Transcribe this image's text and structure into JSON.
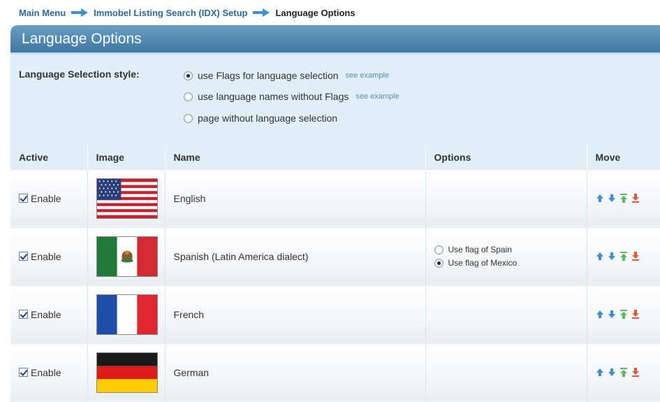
{
  "breadcrumb": {
    "items": [
      "Main Menu",
      "Immobel Listing Search (IDX) Setup"
    ],
    "current": "Language Options"
  },
  "panel": {
    "title": "Language Options"
  },
  "selection_style": {
    "label": "Language Selection style:",
    "options": [
      {
        "label": "use Flags for language selection",
        "link": "see example",
        "checked": true
      },
      {
        "label": "use language names without Flags",
        "link": "see example",
        "checked": false
      },
      {
        "label": "page without language selection",
        "link": "",
        "checked": false
      }
    ]
  },
  "table": {
    "headers": {
      "active": "Active",
      "image": "Image",
      "name": "Name",
      "options": "Options",
      "move": "Move"
    },
    "enable_label": "Enable",
    "rows": [
      {
        "name": "English",
        "flag": "usa",
        "enabled": true
      },
      {
        "name": "Spanish (Latin America dialect)",
        "flag": "mexico",
        "enabled": true,
        "options": [
          {
            "label": "Use flag of Spain",
            "checked": false
          },
          {
            "label": "Use flag of Mexico",
            "checked": true
          }
        ]
      },
      {
        "name": "French",
        "flag": "france",
        "enabled": true
      },
      {
        "name": "German",
        "flag": "germany",
        "enabled": true
      }
    ]
  },
  "icons": {
    "breadcrumb_separator": "arrow-right-icon",
    "move": [
      "move-up-icon",
      "move-down-icon",
      "move-top-icon",
      "move-bottom-icon"
    ]
  },
  "colors": {
    "link": "#2a6a9e",
    "header_bar": "#4a83ae",
    "panel_bg": "#dfeef7",
    "move_blue": "#3a8fd6",
    "move_green": "#5cb85c",
    "move_red": "#e05a3a"
  }
}
